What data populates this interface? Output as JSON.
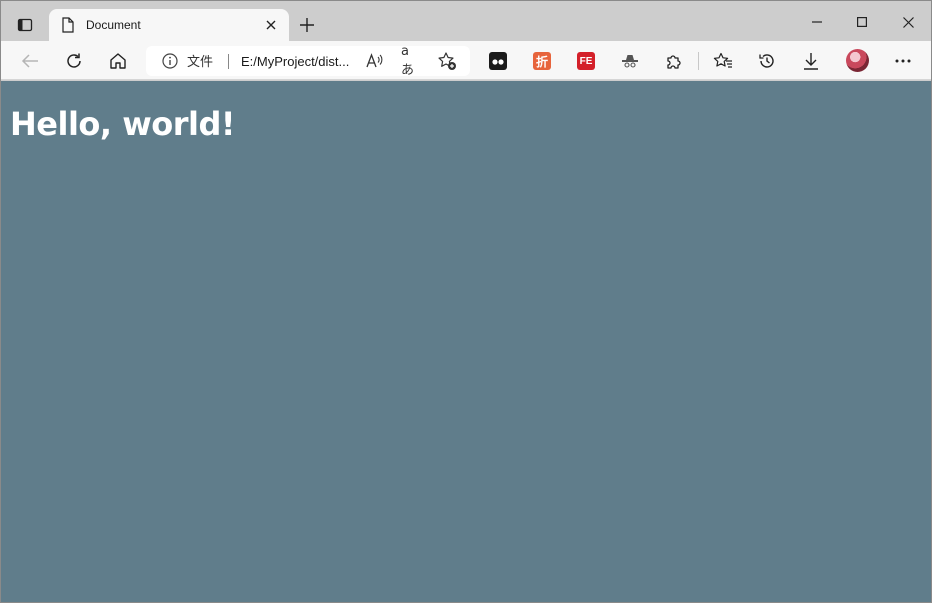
{
  "tab": {
    "title": "Document"
  },
  "address": {
    "scheme_label": "文件",
    "url": "E:/MyProject/dist..."
  },
  "extensions": [
    {
      "name": "tampermonkey",
      "color": "#1b1b1b",
      "glyph": ""
    },
    {
      "name": "zhe",
      "color": "#e7643c",
      "glyph": "折"
    },
    {
      "name": "fe",
      "color": "#d4202a",
      "glyph": "FE"
    },
    {
      "name": "hat",
      "color": "#555555",
      "glyph": ""
    }
  ],
  "page": {
    "heading": "Hello, world!",
    "background": "#607d8b"
  }
}
